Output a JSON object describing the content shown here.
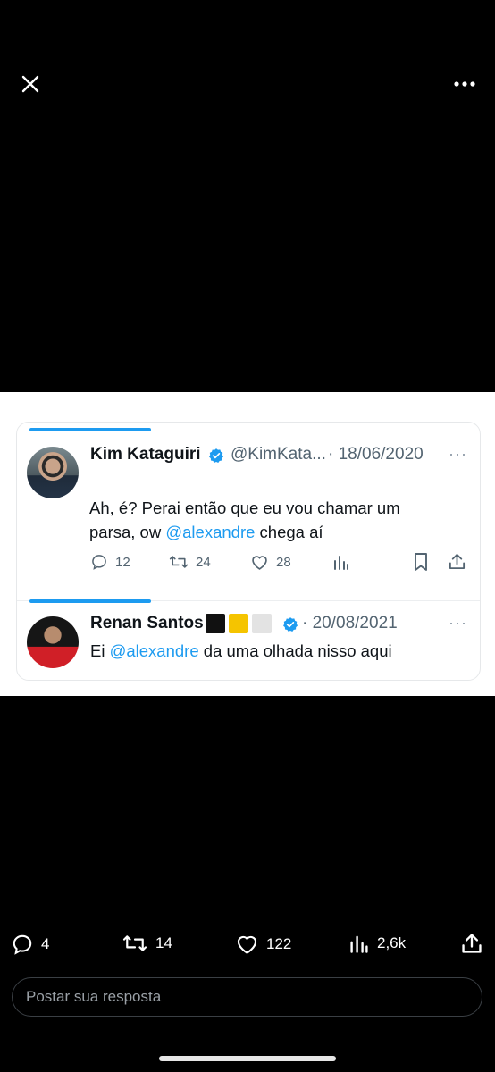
{
  "header": {
    "close_icon": "close-icon",
    "more_icon": "more-horizontal-icon"
  },
  "embedded": {
    "tweet1": {
      "name": "Kim Kataguiri",
      "handle": "@KimKata...",
      "date": "· 18/06/2020",
      "more": "···",
      "text_before": "Ah, é? Perai então que eu vou chamar um parsa, ow ",
      "mention": "@alexandre",
      "text_after": " chega aí",
      "replies": "12",
      "retweets": "24",
      "likes": "28"
    },
    "tweet2": {
      "name": "Renan Santos",
      "date": "· 20/08/2021",
      "more": "···",
      "text_before": "Ei ",
      "mention": "@alexandre",
      "text_after": " da uma olhada nisso aqui",
      "flag_colors": [
        "#111111",
        "#f5c400",
        "#e3e3e3"
      ]
    },
    "accent_color": "#1d9bf0"
  },
  "footer": {
    "replies": "4",
    "reposts": "14",
    "likes": "122",
    "views": "2,6k",
    "reply_placeholder": "Postar sua resposta"
  }
}
